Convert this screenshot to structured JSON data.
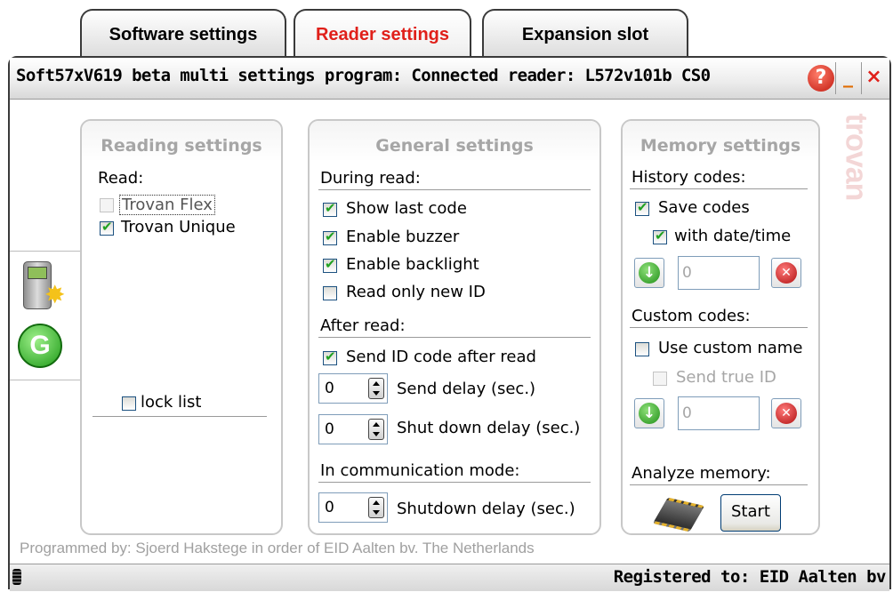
{
  "tabs": [
    {
      "label": "Software settings",
      "active": false
    },
    {
      "label": "Reader settings",
      "active": true
    },
    {
      "label": "Expansion slot",
      "active": false
    }
  ],
  "window": {
    "title": "Soft57xV619 beta multi settings program: Connected reader: L572v101b CS0",
    "help_label": "?",
    "minimize_label": "_",
    "close_label": "×"
  },
  "watermark": "trovan",
  "reading": {
    "title": "Reading settings",
    "read_label": "Read:",
    "items": [
      {
        "label": "Trovan Flex",
        "checked": false,
        "enabled": false
      },
      {
        "label": "Trovan Unique",
        "checked": true,
        "enabled": true
      }
    ],
    "lock_label": "lock list"
  },
  "general": {
    "title": "General settings",
    "during_label": "During read:",
    "during_items": [
      {
        "label": "Show last code",
        "checked": true
      },
      {
        "label": "Enable buzzer",
        "checked": true
      },
      {
        "label": "Enable backlight",
        "checked": true
      },
      {
        "label": "Read only new ID",
        "checked": false
      }
    ],
    "after_label": "After read:",
    "send_id_label": "Send ID code after read",
    "send_delay_value": "0",
    "send_delay_label": "Send delay (sec.)",
    "shutdown_delay_value": "0",
    "shutdown_delay_label": "Shut down delay (sec.)",
    "comm_label": "In communication mode:",
    "comm_shutdown_value": "0",
    "comm_shutdown_label": "Shutdown delay (sec.)"
  },
  "memory": {
    "title": "Memory settings",
    "history_label": "History codes:",
    "save_codes_label": "Save codes",
    "with_date_label": "with date/time",
    "history_count": "0",
    "custom_label": "Custom codes:",
    "use_custom_label": "Use custom name",
    "send_true_label": "Send true ID",
    "custom_count": "0",
    "analyze_label": "Analyze memory:",
    "start_label": "Start"
  },
  "footer": {
    "credits": "Programmed by: Sjoerd Hakstege in order of EID Aalten bv. The Netherlands",
    "registered": "Registered to: EID Aalten bv"
  },
  "colors": {
    "active_tab": "#e0201a",
    "accent_check": "#21a121",
    "panel_title": "#a6a6a6"
  }
}
